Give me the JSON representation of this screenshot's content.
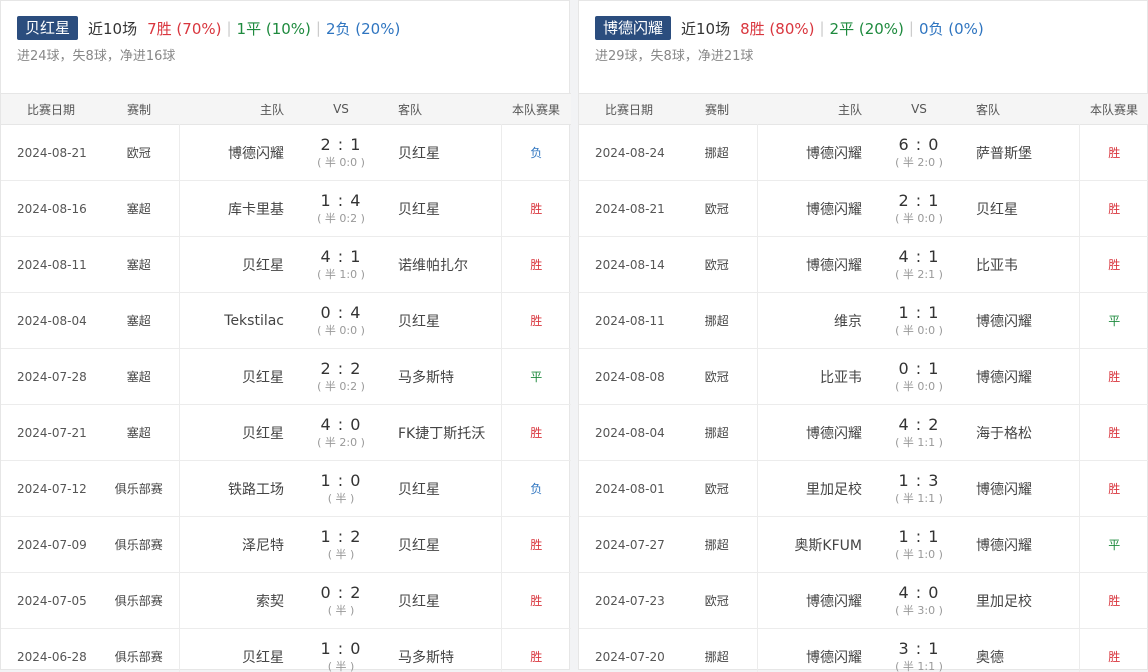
{
  "colors": {
    "badge_bg": "#2b4d7e",
    "win": "#d9363e",
    "draw": "#1e8a3e",
    "loss": "#2f75c0"
  },
  "panels": [
    {
      "team": "贝红星",
      "recent": "近10场",
      "wins": "7胜 (70%)",
      "draws": "1平 (10%)",
      "losses": "2负 (20%)",
      "sep": "|",
      "goals_summary": "进24球，失8球，净进16球",
      "headers": {
        "date": "比赛日期",
        "comp": "赛制",
        "home": "主队",
        "vs": "VS",
        "away": "客队",
        "result": "本队赛果"
      },
      "matches": [
        {
          "date": "2024-08-21",
          "comp": "欧冠",
          "home": "博德闪耀",
          "score": "2 : 1",
          "half": "( 半 0:0 )",
          "away": "贝红星",
          "result": "负",
          "rtype": "loss"
        },
        {
          "date": "2024-08-16",
          "comp": "塞超",
          "home": "库卡里基",
          "score": "1 : 4",
          "half": "( 半 0:2 )",
          "away": "贝红星",
          "result": "胜",
          "rtype": "win"
        },
        {
          "date": "2024-08-11",
          "comp": "塞超",
          "home": "贝红星",
          "score": "4 : 1",
          "half": "( 半 1:0 )",
          "away": "诺维帕扎尔",
          "result": "胜",
          "rtype": "win"
        },
        {
          "date": "2024-08-04",
          "comp": "塞超",
          "home": "Tekstilac",
          "score": "0 : 4",
          "half": "( 半 0:0 )",
          "away": "贝红星",
          "result": "胜",
          "rtype": "win"
        },
        {
          "date": "2024-07-28",
          "comp": "塞超",
          "home": "贝红星",
          "score": "2 : 2",
          "half": "( 半 0:2 )",
          "away": "马多斯特",
          "result": "平",
          "rtype": "draw"
        },
        {
          "date": "2024-07-21",
          "comp": "塞超",
          "home": "贝红星",
          "score": "4 : 0",
          "half": "( 半 2:0 )",
          "away": "FK捷丁斯托沃",
          "result": "胜",
          "rtype": "win"
        },
        {
          "date": "2024-07-12",
          "comp": "俱乐部赛",
          "home": "铁路工场",
          "score": "1 : 0",
          "half": "( 半 )",
          "away": "贝红星",
          "result": "负",
          "rtype": "loss"
        },
        {
          "date": "2024-07-09",
          "comp": "俱乐部赛",
          "home": "泽尼特",
          "score": "1 : 2",
          "half": "( 半 )",
          "away": "贝红星",
          "result": "胜",
          "rtype": "win"
        },
        {
          "date": "2024-07-05",
          "comp": "俱乐部赛",
          "home": "索契",
          "score": "0 : 2",
          "half": "( 半 )",
          "away": "贝红星",
          "result": "胜",
          "rtype": "win"
        },
        {
          "date": "2024-06-28",
          "comp": "俱乐部赛",
          "home": "贝红星",
          "score": "1 : 0",
          "half": "( 半 )",
          "away": "马多斯特",
          "result": "胜",
          "rtype": "win"
        }
      ]
    },
    {
      "team": "博德闪耀",
      "recent": "近10场",
      "wins": "8胜 (80%)",
      "draws": "2平 (20%)",
      "losses": "0负 (0%)",
      "sep": "|",
      "goals_summary": "进29球，失8球，净进21球",
      "headers": {
        "date": "比赛日期",
        "comp": "赛制",
        "home": "主队",
        "vs": "VS",
        "away": "客队",
        "result": "本队赛果"
      },
      "matches": [
        {
          "date": "2024-08-24",
          "comp": "挪超",
          "home": "博德闪耀",
          "score": "6 : 0",
          "half": "( 半 2:0 )",
          "away": "萨普斯堡",
          "result": "胜",
          "rtype": "win"
        },
        {
          "date": "2024-08-21",
          "comp": "欧冠",
          "home": "博德闪耀",
          "score": "2 : 1",
          "half": "( 半 0:0 )",
          "away": "贝红星",
          "result": "胜",
          "rtype": "win"
        },
        {
          "date": "2024-08-14",
          "comp": "欧冠",
          "home": "博德闪耀",
          "score": "4 : 1",
          "half": "( 半 2:1 )",
          "away": "比亚韦",
          "result": "胜",
          "rtype": "win"
        },
        {
          "date": "2024-08-11",
          "comp": "挪超",
          "home": "维京",
          "score": "1 : 1",
          "half": "( 半 0:0 )",
          "away": "博德闪耀",
          "result": "平",
          "rtype": "draw"
        },
        {
          "date": "2024-08-08",
          "comp": "欧冠",
          "home": "比亚韦",
          "score": "0 : 1",
          "half": "( 半 0:0 )",
          "away": "博德闪耀",
          "result": "胜",
          "rtype": "win"
        },
        {
          "date": "2024-08-04",
          "comp": "挪超",
          "home": "博德闪耀",
          "score": "4 : 2",
          "half": "( 半 1:1 )",
          "away": "海于格松",
          "result": "胜",
          "rtype": "win"
        },
        {
          "date": "2024-08-01",
          "comp": "欧冠",
          "home": "里加足校",
          "score": "1 : 3",
          "half": "( 半 1:1 )",
          "away": "博德闪耀",
          "result": "胜",
          "rtype": "win"
        },
        {
          "date": "2024-07-27",
          "comp": "挪超",
          "home": "奥斯KFUM",
          "score": "1 : 1",
          "half": "( 半 1:0 )",
          "away": "博德闪耀",
          "result": "平",
          "rtype": "draw"
        },
        {
          "date": "2024-07-23",
          "comp": "欧冠",
          "home": "博德闪耀",
          "score": "4 : 0",
          "half": "( 半 3:0 )",
          "away": "里加足校",
          "result": "胜",
          "rtype": "win"
        },
        {
          "date": "2024-07-20",
          "comp": "挪超",
          "home": "博德闪耀",
          "score": "3 : 1",
          "half": "( 半 1:1 )",
          "away": "奥德",
          "result": "胜",
          "rtype": "win"
        }
      ]
    }
  ]
}
